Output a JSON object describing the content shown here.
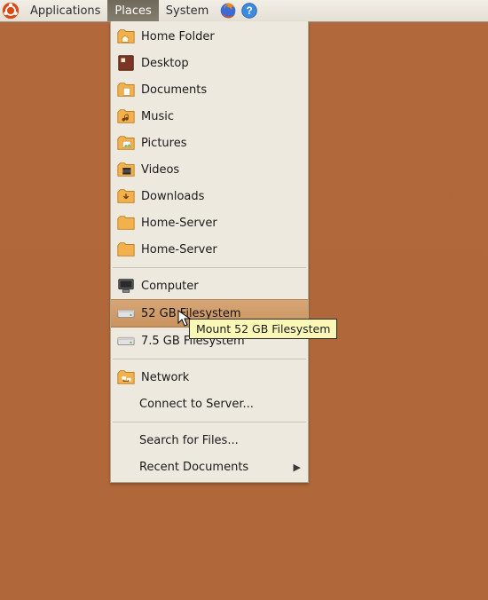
{
  "panel": {
    "menus": {
      "applications": "Applications",
      "places": "Places",
      "system": "System"
    }
  },
  "places_menu": {
    "home": "Home Folder",
    "desktop": "Desktop",
    "documents": "Documents",
    "music": "Music",
    "pictures": "Pictures",
    "videos": "Videos",
    "downloads": "Downloads",
    "home_server1": "Home-Server",
    "home_server2": "Home-Server",
    "computer": "Computer",
    "fs52": "52 GB Filesystem",
    "fs75": "7.5 GB Filesystem",
    "network": "Network",
    "connect": "Connect to Server...",
    "search": "Search for Files...",
    "recent": "Recent Documents"
  },
  "tooltip": "Mount 52 GB Filesystem"
}
